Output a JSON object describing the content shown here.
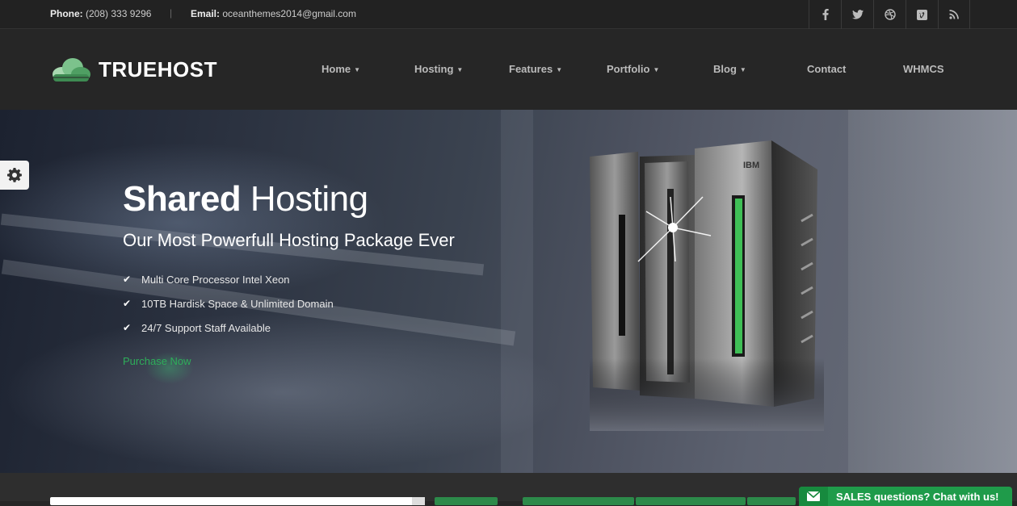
{
  "topbar": {
    "phone_label": "Phone:",
    "phone_value": "(208) 333 9296",
    "separator": "|",
    "email_label": "Email:",
    "email_value": "oceanthemes2014@gmail.com",
    "social": [
      {
        "icon": "facebook-icon",
        "glyph": "f"
      },
      {
        "icon": "twitter-icon",
        "glyph": "t"
      },
      {
        "icon": "dribbble-icon",
        "glyph": "d"
      },
      {
        "icon": "vimeo-icon",
        "glyph": "v"
      },
      {
        "icon": "rss-icon",
        "glyph": "r"
      }
    ]
  },
  "header": {
    "logo_text": "TRUEHOST",
    "nav": [
      {
        "label": "Home",
        "dropdown": true
      },
      {
        "label": "Hosting",
        "dropdown": true
      },
      {
        "label": "Features",
        "dropdown": true
      },
      {
        "label": "Portfolio",
        "dropdown": true
      },
      {
        "label": "Blog",
        "dropdown": true
      },
      {
        "label": "Contact",
        "dropdown": false
      },
      {
        "label": "WHMCS",
        "dropdown": false
      }
    ],
    "caret": "▼"
  },
  "hero": {
    "title_bold": "Shared",
    "title_rest": " Hosting",
    "subtitle": "Our Most Powerfull Hosting Package Ever",
    "features": [
      "Multi Core Processor Intel Xeon",
      "10TB Hardisk Space & Unlimited Domain",
      "24/7 Support Staff Available"
    ],
    "check": "✔",
    "cta": "Purchase Now",
    "server_brand": "IBM"
  },
  "chat": {
    "label": "SALES questions? Chat with us!"
  },
  "colors": {
    "accent_green": "#2eae5a",
    "chat_green": "#1f9b4a",
    "topbar_bg": "#222222",
    "header_bg": "#262626"
  }
}
